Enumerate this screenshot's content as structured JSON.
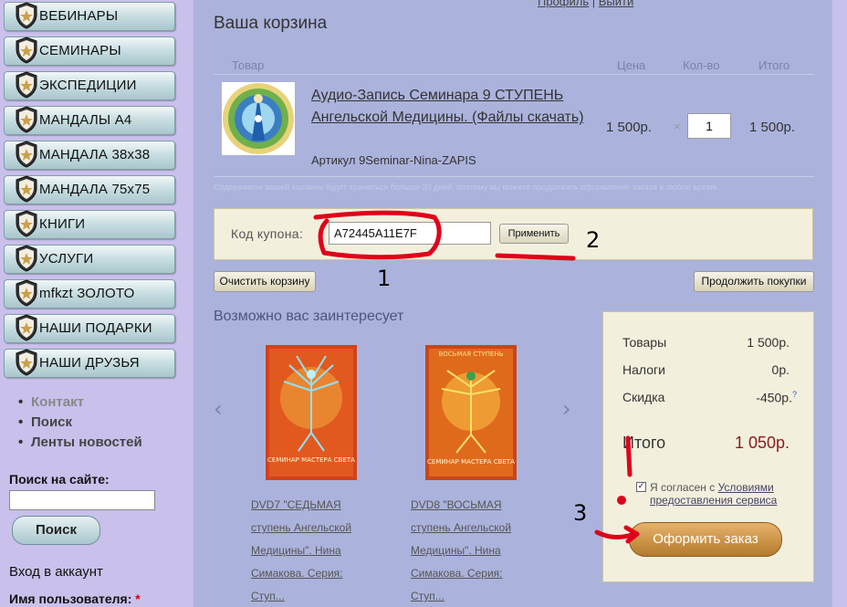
{
  "sidebar": {
    "menu": [
      {
        "label": "ВЕБИНАРЫ"
      },
      {
        "label": "СЕМИНАРЫ"
      },
      {
        "label": "ЭКСПЕДИЦИИ"
      },
      {
        "label": "МАНДАЛЫ А4"
      },
      {
        "label": "МАНДАЛА 38x38"
      },
      {
        "label": "МАНДАЛА 75x75"
      },
      {
        "label": "КНИГИ"
      },
      {
        "label": "УСЛУГИ"
      },
      {
        "label": "mfkzt ЗОЛОТО"
      },
      {
        "label": "НАШИ ПОДАРКИ"
      },
      {
        "label": "НАШИ ДРУЗЬЯ"
      }
    ],
    "links": [
      "Контакт",
      "Поиск",
      "Ленты новостей"
    ],
    "search_label": "Поиск на сайте:",
    "search_value": "",
    "search_button": "Поиск",
    "login_title": "Вход в аккаунт",
    "username_label": "Имя пользователя:",
    "required_mark": "*"
  },
  "header": {
    "profile_link": "Профиль",
    "separator": "|",
    "logout_link": "Выйти"
  },
  "cart": {
    "title": "Ваша корзина",
    "columns": {
      "product": "Товар",
      "price": "Цена",
      "qty": "Кол-во",
      "total": "Итого"
    },
    "item": {
      "title": "Аудио-Запись Семинара 9 СТУПЕНЬ Ангельской Медицины. (Файлы скачать)",
      "sku": "Артикул 9Seminar-Nina-ZAPIS",
      "price": "1 500р.",
      "times": "×",
      "qty": "1",
      "total": "1 500р."
    },
    "notice": "Содержимое вашей корзины будет храниться больше 30 дней, поэтому вы можете продолжить оформление заказа в любое время.",
    "coupon_label": "Код купона:",
    "coupon_value": "A72445A11E7F",
    "coupon_apply": "Применить",
    "clear_button": "Очистить корзину",
    "continue_button": "Продолжить покупки"
  },
  "recommend": {
    "title": "Возможно вас заинтересует",
    "prev": "‹",
    "next": "›",
    "items": [
      {
        "lines": [
          "DVD7 \"СЕДЬМАЯ",
          "ступень Ангельской",
          "Медицины\". Нина",
          "Симакова. Серия:",
          "Ступ..."
        ],
        "cover": "СЕМИНАР МАСТЕРА СВЕТА"
      },
      {
        "lines": [
          "DVD8 \"ВОСЬМАЯ",
          "ступень Ангельской",
          "Медицины\". Нина",
          "Симакова. Серия:",
          "Ступ..."
        ],
        "cover": "СЕМИНАР МАСТЕРА СВЕТА",
        "cover_top": "ВОСЬМАЯ СТУПЕНЬ"
      }
    ]
  },
  "summary": {
    "goods_label": "Товары",
    "goods_value": "1 500р.",
    "tax_label": "Налоги",
    "tax_value": "0р.",
    "discount_label": "Скидка",
    "discount_value": "-450р.",
    "discount_help": "?",
    "total_label": "Итого",
    "total_value": "1 050р.",
    "agree_prefix": "Я согласен с ",
    "agree_link": "Условиями предоставления сервиса",
    "order_button": "Оформить заказ"
  },
  "annotations": {
    "n1": "1",
    "n2": "2",
    "n3": "3"
  },
  "colors": {
    "total_red": "#8b1a1a",
    "annotation_red": "#e0001a",
    "order_button": "#c58a3a"
  }
}
